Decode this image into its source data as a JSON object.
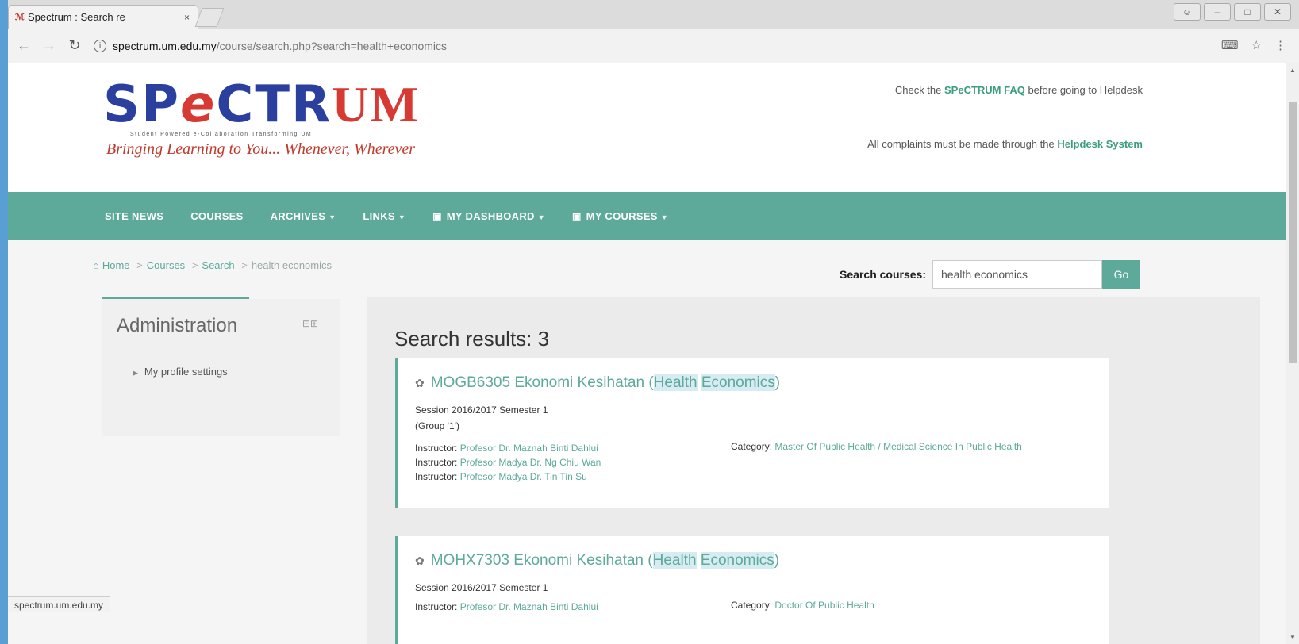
{
  "browser": {
    "tab_title": "Spectrum : Search re",
    "tab_close": "×",
    "url_host": "spectrum.um.edu.my",
    "url_path": "/course/search.php?search=health+economics",
    "status_text": "spectrum.um.edu.my"
  },
  "header": {
    "logo_tagline_small": "Student Powered e-Collaboration Transforming UM",
    "logo_tagline": "Bringing Learning to You... Whenever, Wherever",
    "notice_1_prefix": "Check the ",
    "notice_1_link": "SPeCTRUM FAQ",
    "notice_1_suffix": " before going to Helpdesk",
    "notice_2_prefix": "All complaints must be made through the ",
    "notice_2_link": "Helpdesk System"
  },
  "nav": {
    "site_news": "SITE NEWS",
    "courses": "COURSES",
    "archives": "ARCHIVES",
    "links": "LINKS",
    "my_dashboard": "MY DASHBOARD",
    "my_courses": "MY COURSES"
  },
  "breadcrumb": {
    "home": "Home",
    "courses": "Courses",
    "search": "Search",
    "current": "health economics"
  },
  "search": {
    "label": "Search courses:",
    "value": "health economics",
    "button": "Go"
  },
  "admin": {
    "title": "Administration",
    "item": "My profile settings"
  },
  "results": {
    "heading": "Search results: 3",
    "courses": [
      {
        "code_title": "MOGB6305 Ekonomi Kesihatan (",
        "hl1": "Health",
        "hl2": "Economics",
        "close": ")",
        "session": "Session 2016/2017 Semester 1",
        "group": "(Group '1')",
        "instructor_label": "Instructor:",
        "instructors": [
          "Profesor Dr. Maznah Binti Dahlui",
          "Profesor Madya Dr. Ng Chiu Wan",
          "Profesor Madya Dr. Tin Tin Su"
        ],
        "category_label": "Category:",
        "category": "Master Of Public Health / Medical Science In Public Health"
      },
      {
        "code_title": "MOHX7303 Ekonomi Kesihatan (",
        "hl1": "Health",
        "hl2": "Economics",
        "close": ")",
        "session": "Session 2016/2017 Semester 1",
        "instructor_label": "Instructor:",
        "instructors": [
          "Profesor Dr. Maznah Binti Dahlui"
        ],
        "category_label": "Category:",
        "category": "Doctor Of Public Health"
      }
    ]
  },
  "colors": {
    "accent": "#5da99a",
    "logo_blue": "#2a3f9e",
    "logo_red": "#d63a33"
  }
}
